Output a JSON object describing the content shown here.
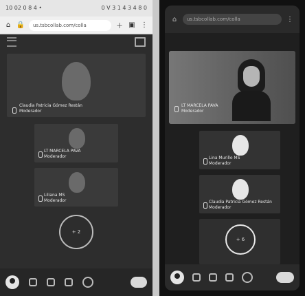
{
  "left_phone": {
    "status_bar": {
      "left_text": "10 02 0 8 4 •",
      "right_text": "0 V 3 1 4 3 4 8 0"
    },
    "browser": {
      "url": "us.tsbcollab.com/colla",
      "icons": [
        "home-icon",
        "lock-icon",
        "plus-icon",
        "tabs-icon",
        "more-icon"
      ]
    },
    "tiles": [
      {
        "name": "Claudia Patricia Gómez Restán",
        "role": "Moderador"
      },
      {
        "name": "LT MARCELA PAVA",
        "role": "Moderador"
      },
      {
        "name": "Liliana MS",
        "role": "Moderador"
      }
    ],
    "counter": "+ 2"
  },
  "right_phone": {
    "browser": {
      "url": "us.tsbcollab.com/colla"
    },
    "video_tile": {
      "name": "LT MARCELA PAVA",
      "role": "Moderador"
    },
    "tiles": [
      {
        "name": "Lina Murillo MS",
        "role": "Moderador"
      },
      {
        "name": "Claudia Patricia Gómez Restán",
        "role": "Moderador"
      }
    ],
    "counter": "+ 6"
  }
}
